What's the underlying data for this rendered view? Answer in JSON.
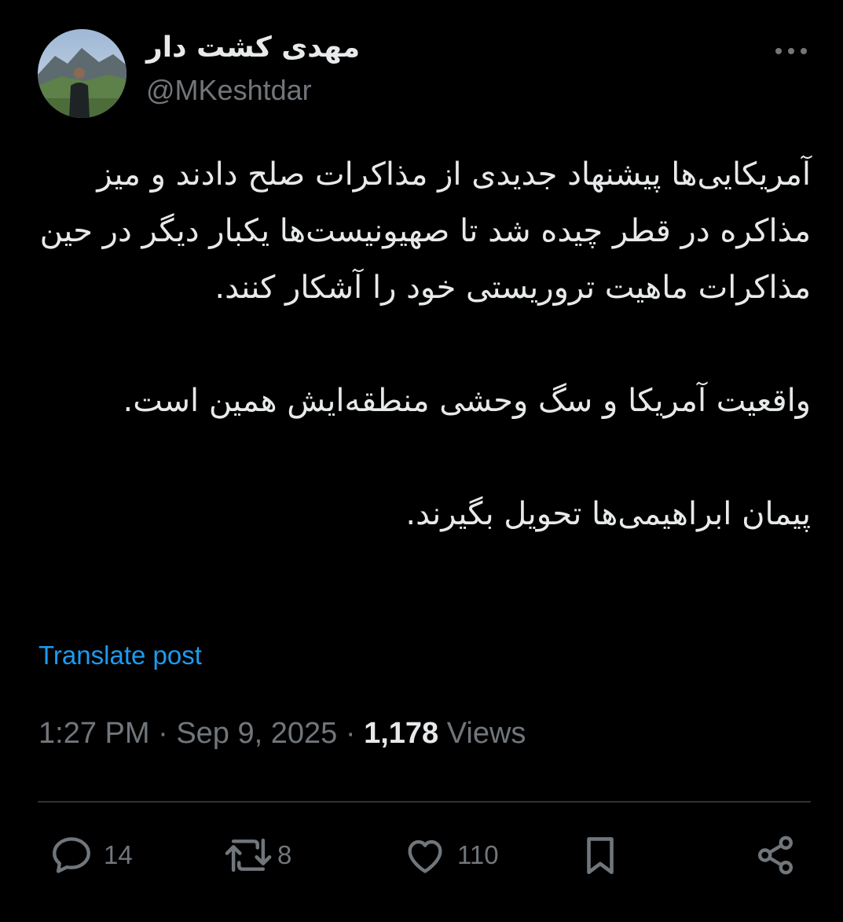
{
  "author": {
    "display_name": "مهدی کشت دار",
    "handle": "@MKeshtdar"
  },
  "tweet": {
    "paragraph_1": "آمریکایی‌ها پیشنهاد جدیدی از مذاکرات صلح دادند و میز مذاکره در قطر چیده شد تا صهیونیست‌ها یکبار دیگر در حین مذاکرات ماهیت تروریستی خود را آشکار کنند.",
    "paragraph_2": "واقعیت آمریکا و سگ وحشی منطقه‌ایش همین است.",
    "paragraph_3": "پیمان ابراهیمی‌ها تحویل بگیرند."
  },
  "translate_label": "Translate post",
  "meta": {
    "time": "1:27 PM",
    "separator": "·",
    "date": "Sep 9, 2025",
    "views_count": "1,178",
    "views_label": "Views"
  },
  "actions": {
    "replies": "14",
    "reposts": "8",
    "likes": "110"
  },
  "icons": {
    "more": "more-horizontal-icon",
    "reply": "reply-bubble-icon",
    "repost": "repost-arrows-icon",
    "like": "heart-icon",
    "bookmark": "bookmark-icon",
    "share": "share-icon"
  },
  "colors": {
    "background": "#000000",
    "text": "#e7e9ea",
    "muted": "#71767b",
    "link": "#1d9bf0",
    "divider": "#2f3336"
  }
}
